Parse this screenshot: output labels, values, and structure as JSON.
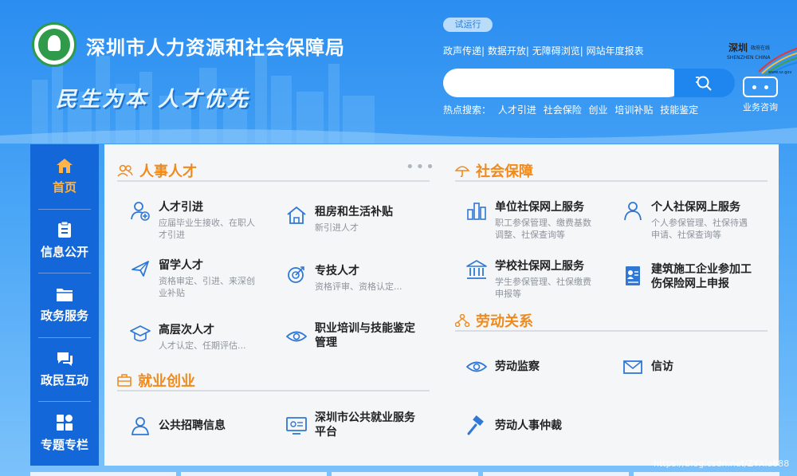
{
  "header": {
    "site_title": "深圳市人力资源和社会保障局",
    "slogan": "民生为本 人才优先",
    "trial_badge": "试运行",
    "top_links": [
      "政声传递",
      "数据开放",
      "无障碍浏览",
      "网站年度报表"
    ],
    "search_placeholder": "",
    "hot_label": "热点搜索：",
    "hot_terms": [
      "人才引进",
      "社会保险",
      "创业",
      "培训补贴",
      "技能鉴定"
    ],
    "consult_label": "业务咨询",
    "sz_logo_text": "深圳 政府在线 SHENZHEN CHINA www.sz.gov"
  },
  "sidenav": [
    {
      "label": "首页",
      "icon": "home-icon"
    },
    {
      "label": "信息公开",
      "icon": "clipboard-icon"
    },
    {
      "label": "政务服务",
      "icon": "folder-icon"
    },
    {
      "label": "政民互动",
      "icon": "chat-icon"
    },
    {
      "label": "专题专栏",
      "icon": "grid-icon"
    }
  ],
  "sections": {
    "talent": {
      "title": "人事人才",
      "items": [
        {
          "title": "人才引进",
          "desc1": "应届毕业生接收、在职人",
          "desc2": "才引进"
        },
        {
          "title": "租房和生活补贴",
          "desc1": "新引进人才",
          "desc2": ""
        },
        {
          "title": "留学人才",
          "desc1": "资格审定、引进、来深创",
          "desc2": "业补贴"
        },
        {
          "title": "专技人才",
          "desc1": "资格评审、资格认定...",
          "desc2": ""
        },
        {
          "title": "高层次人才",
          "desc1": "人才认定、任期评估...",
          "desc2": ""
        },
        {
          "title1": "职业培训与技能鉴定",
          "title2": "管理"
        }
      ]
    },
    "employment": {
      "title": "就业创业",
      "items": [
        {
          "title": "公共招聘信息"
        },
        {
          "title1": "深圳市公共就业服务",
          "title2": "平台"
        }
      ]
    },
    "social": {
      "title": "社会保障",
      "items": [
        {
          "title": "单位社保网上服务",
          "desc1": "职工参保管理、缴费基数",
          "desc2": "调整、社保查询等"
        },
        {
          "title": "个人社保网上服务",
          "desc1": "个人参保管理、社保待遇",
          "desc2": "申请、社保查询等"
        },
        {
          "title": "学校社保网上服务",
          "desc1": "学生参保管理、社保缴费",
          "desc2": "申报等"
        },
        {
          "title1": "建筑施工企业参加工",
          "title2": "伤保险网上申报"
        }
      ]
    },
    "labor": {
      "title": "劳动关系",
      "items": [
        {
          "title": "劳动监察"
        },
        {
          "title": "信访"
        },
        {
          "title": "劳动人事仲裁"
        }
      ]
    }
  },
  "watermark": "https://blog.csdn.net/ZYXia888",
  "colors": {
    "accent": "#f08a1c",
    "nav": "#1467d8",
    "icon": "#2f78d6"
  }
}
